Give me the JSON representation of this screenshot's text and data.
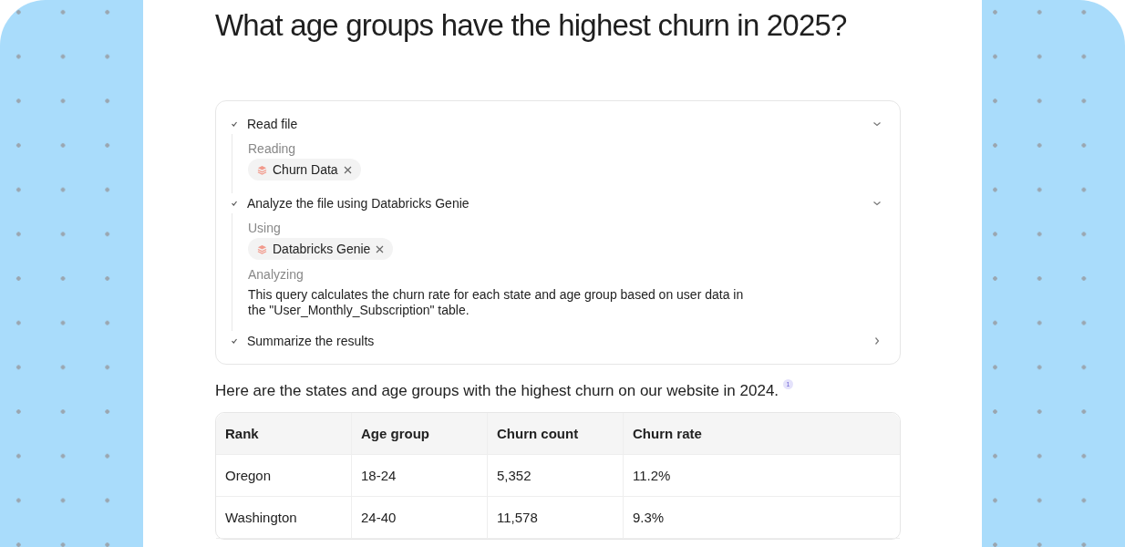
{
  "title": "What age groups have the highest churn in 2025?",
  "steps": [
    {
      "title": "Read file",
      "done": true,
      "expanded": true,
      "details": [
        {
          "kind": "label",
          "text": "Reading"
        },
        {
          "kind": "chip",
          "text": "Churn Data"
        }
      ]
    },
    {
      "title": "Analyze the file using Databricks Genie",
      "done": true,
      "expanded": true,
      "details": [
        {
          "kind": "label",
          "text": "Using"
        },
        {
          "kind": "chip",
          "text": "Databricks Genie"
        },
        {
          "kind": "label",
          "text": "Analyzing"
        },
        {
          "kind": "text",
          "text": "This query calculates the churn rate for each state and age group based on user data in the \"User_Monthly_Subscription\" table."
        }
      ]
    },
    {
      "title": "Summarize the results",
      "done": true,
      "expanded": false
    }
  ],
  "answer": {
    "text": "Here are the states and age groups with the highest churn on our website in 2024.",
    "citation": "1"
  },
  "table": {
    "columns": [
      "Rank",
      "Age group",
      "Churn count",
      "Churn rate"
    ],
    "rows": [
      [
        "Oregon",
        "18-24",
        "5,352",
        "11.2%"
      ],
      [
        "Washington",
        "24-40",
        "11,578",
        "9.3%"
      ]
    ]
  }
}
